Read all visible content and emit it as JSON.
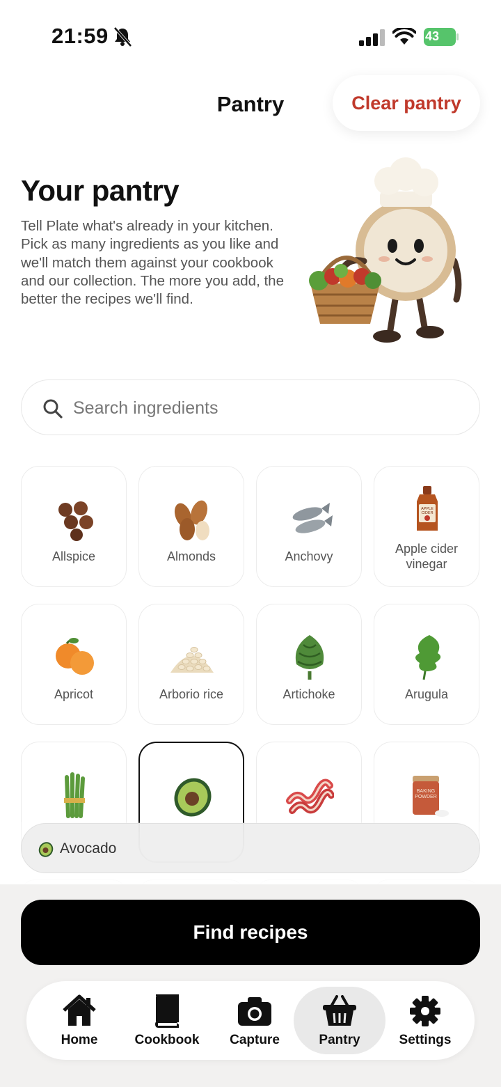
{
  "status": {
    "time": "21:59",
    "battery": "43"
  },
  "header": {
    "title": "Pantry",
    "clear_label": "Clear pantry"
  },
  "hero": {
    "title": "Your pantry",
    "description": "Tell Plate what's already in your kitchen. Pick as many ingredients as you like and we'll match them against your cookbook and our collection. The more you add, the better the recipes we'll find."
  },
  "search": {
    "placeholder": "Search ingredients",
    "value": ""
  },
  "ingredients": [
    {
      "label": "Allspice",
      "icon": "allspice-icon"
    },
    {
      "label": "Almonds",
      "icon": "almonds-icon"
    },
    {
      "label": "Anchovy",
      "icon": "anchovy-icon"
    },
    {
      "label": "Apple cider vinegar",
      "icon": "apple-cider-vinegar-icon"
    },
    {
      "label": "Apricot",
      "icon": "apricot-icon"
    },
    {
      "label": "Arborio rice",
      "icon": "arborio-rice-icon"
    },
    {
      "label": "Artichoke",
      "icon": "artichoke-icon"
    },
    {
      "label": "Arugula",
      "icon": "arugula-icon"
    },
    {
      "label": "",
      "icon": "asparagus-icon"
    },
    {
      "label": "",
      "icon": "avocado-icon",
      "selected": true
    },
    {
      "label": "",
      "icon": "bacon-icon"
    },
    {
      "label": "",
      "icon": "baking-powder-icon",
      "jar_text": [
        "BAKING",
        "POWDER"
      ]
    }
  ],
  "vinegar_label_text": [
    "APPLE",
    "CIDER"
  ],
  "selected_chip": {
    "label": "Avocado"
  },
  "find_button": "Find recipes",
  "tabs": [
    {
      "label": "Home"
    },
    {
      "label": "Cookbook"
    },
    {
      "label": "Capture"
    },
    {
      "label": "Pantry",
      "active": true
    },
    {
      "label": "Settings"
    }
  ],
  "colors": {
    "accent_red": "#c0392b",
    "battery_green": "#56c46b",
    "primary_button": "#000000"
  }
}
